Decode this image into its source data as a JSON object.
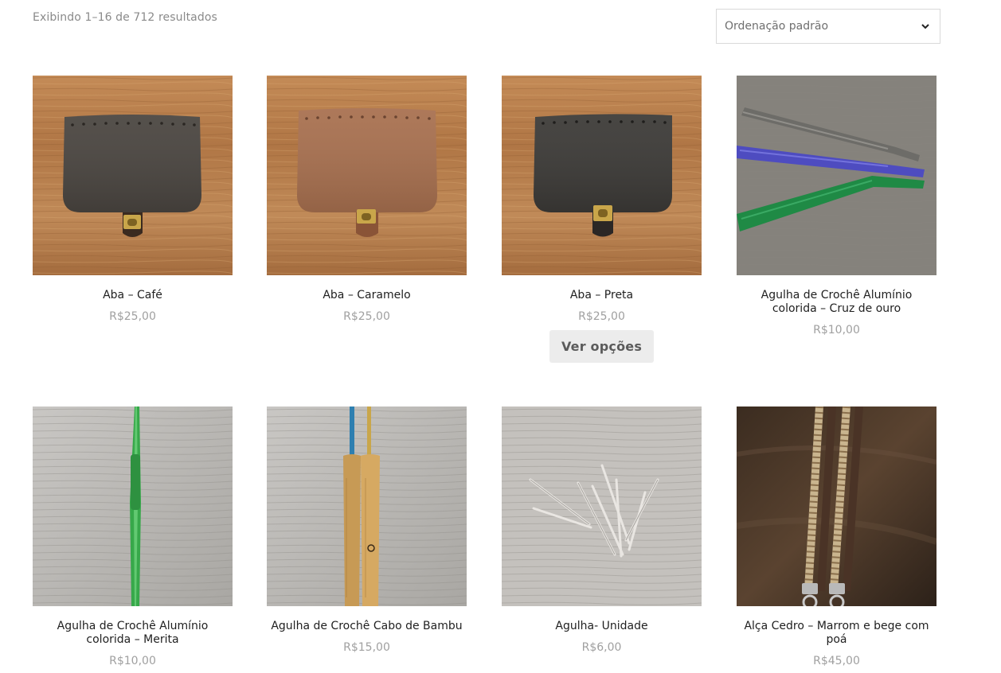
{
  "toolbar": {
    "result_count": "Exibindo 1–16 de 712 resultados",
    "sort_selected": "Ordenação padrão"
  },
  "products": [
    {
      "title": "Aba – Café",
      "price": "R$25,00"
    },
    {
      "title": "Aba – Caramelo",
      "price": "R$25,00"
    },
    {
      "title": "Aba – Preta",
      "price": "R$25,00",
      "button": "Ver opções"
    },
    {
      "title": "Agulha de Crochê Alumínio colorida – Cruz de ouro",
      "price": "R$10,00"
    },
    {
      "title": "Agulha de Crochê Alumínio colorida – Merita",
      "price": "R$10,00"
    },
    {
      "title": "Agulha de Crochê Cabo de Bambu",
      "price": "R$15,00"
    },
    {
      "title": "Agulha- Unidade",
      "price": "R$6,00"
    },
    {
      "title": "Alça Cedro – Marrom e bege com poá",
      "price": "R$45,00"
    }
  ],
  "colors": {
    "wood": "#b97f4c",
    "flap_cafe": "#4a4540",
    "flap_caramelo": "#a8704f",
    "flap_preta": "#3c3a37",
    "button_bg": "#ececec"
  }
}
